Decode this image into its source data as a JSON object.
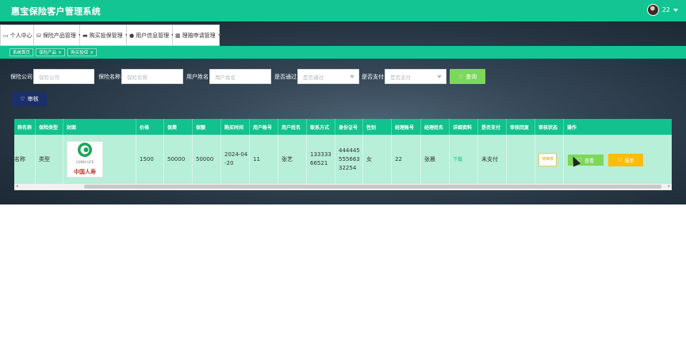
{
  "app": {
    "title": "惠宝保险客户管理系统",
    "user": "22"
  },
  "menu": [
    {
      "label": "个人中心",
      "icon": "calendar-icon"
    },
    {
      "label": "保险产品管理",
      "icon": "database-icon"
    },
    {
      "label": "购买投保管理",
      "icon": "monitor-icon"
    },
    {
      "label": "用户信息管理",
      "icon": "user-icon"
    },
    {
      "label": "理赔申请管理",
      "icon": "grid-icon"
    }
  ],
  "tabs": [
    {
      "label": "系统首页"
    },
    {
      "label": "保险产品",
      "close": "×"
    },
    {
      "label": "购买投保",
      "close": "×"
    }
  ],
  "search": {
    "company_label": "保险公司",
    "company_placeholder": "保险公司",
    "name_label": "保险名称",
    "name_placeholder": "保险名称",
    "user_label": "用户姓名",
    "user_placeholder": "用户姓名",
    "pass_label": "是否通过",
    "pass_placeholder": "是否通过",
    "paid_label": "是否支付",
    "paid_placeholder": "是否支付",
    "button": "查询"
  },
  "audit_button": "审核",
  "table": {
    "headers": [
      "称名称",
      "保险类型",
      "封面",
      "价格",
      "保费",
      "保额",
      "购买时间",
      "用户账号",
      "用户姓名",
      "联系方式",
      "身份证号",
      "性别",
      "经理账号",
      "经理姓名",
      "详细资料",
      "是否支付",
      "审核回复",
      "审核状态",
      "操作"
    ],
    "row": {
      "name": "名称",
      "type": "类型",
      "cover_text": "中国人寿",
      "cover_sub": "CHINA LIFE",
      "price": "1500",
      "premium": "50000",
      "amount": "50000",
      "purchase_time": "2024-04-20",
      "account": "11",
      "user_name": "张艺",
      "contact": "13333366521",
      "id_no": "444445555663 32254",
      "gender": "女",
      "manager_account": "22",
      "manager_name": "张晨",
      "details": "下载",
      "paid": "未支付",
      "reply": "",
      "status": "待审核",
      "view": "查看",
      "claim": "报单"
    }
  },
  "colors": {
    "primary": "#13c592",
    "accent_green": "#7cd75b",
    "navy": "#1b2f6b",
    "amber": "#f9bd0c"
  }
}
